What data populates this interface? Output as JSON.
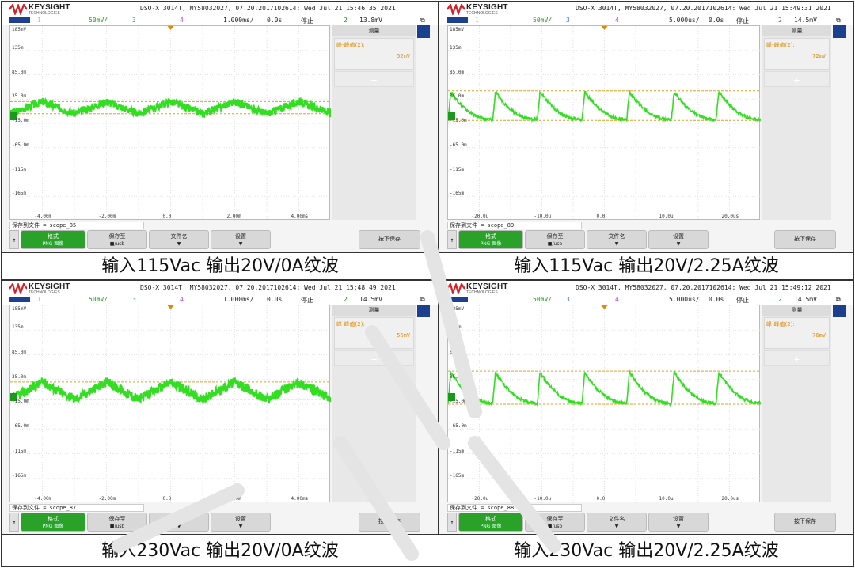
{
  "captions": [
    "输入115Vac 输出20V/0A纹波",
    "输入115Vac 输出20V/2.25A纹波",
    "输入230Vac 输出20V/0A纹波",
    "输入230Vac 输出20V/2.25A纹波"
  ],
  "brand": "KEYSIGHT",
  "brand_sub": "TECHNOLOGIES",
  "panels": [
    {
      "header": "DSO-X 3014T, MY58032027, 07.20.2017102614: Wed Jul 21 15:46:35 2021",
      "ch1": "1",
      "ch2_scale": "50mV/",
      "ch3": "3",
      "ch4": "4",
      "timebase": "1.000ms/",
      "delay": "0.0s",
      "status": "停止",
      "trig_ch": "2",
      "trig_level": "13.8mV",
      "meas_tab": "测量",
      "meas_label": "峰-峰值(2):",
      "meas_value": "52mV",
      "yticks": [
        "185mV",
        "135m",
        "85.0m",
        "35.0m",
        "-15.0m",
        "-65.0m",
        "-115m",
        "-165m"
      ],
      "xticks": [
        "-4.00m",
        "-2.00m",
        "0.0",
        "2.00m",
        "4.00ms"
      ],
      "save_path_label": "保存到文件 =",
      "save_path": "scope_85",
      "buttons": [
        "格式",
        "PNG 图像",
        "保存至",
        "■/usb",
        "文件名",
        "设置",
        "按下保存"
      ]
    },
    {
      "header": "DSO-X 3014T, MY58032027, 07.20.2017102614: Wed Jul 21 15:49:31 2021",
      "ch1": "1",
      "ch2_scale": "50mV/",
      "ch3": "3",
      "ch4": "4",
      "timebase": "5.000us/",
      "delay": "0.0s",
      "status": "停止",
      "trig_ch": "2",
      "trig_level": "14.5mV",
      "meas_tab": "测量",
      "meas_label": "峰-峰值(2):",
      "meas_value": "72mV",
      "yticks": [
        "185mV",
        "135m",
        "85.0m",
        "35.0m",
        "-15.0m",
        "-65.0m",
        "-115m",
        "-165m"
      ],
      "xticks": [
        "-20.0u",
        "-10.0u",
        "0.0",
        "10.0u",
        "20.0us"
      ],
      "save_path_label": "保存到文件 =",
      "save_path": "scope_89",
      "buttons": [
        "格式",
        "PNG 图像",
        "保存至",
        "■/usb",
        "文件名",
        "设置",
        "按下保存"
      ]
    },
    {
      "header": "DSO-X 3014T, MY58032027, 07.20.2017102614: Wed Jul 21 15:48:49 2021",
      "ch1": "1",
      "ch2_scale": "50mV/",
      "ch3": "3",
      "ch4": "4",
      "timebase": "1.000ms/",
      "delay": "0.0s",
      "status": "停止",
      "trig_ch": "2",
      "trig_level": "14.5mV",
      "meas_tab": "测量",
      "meas_label": "峰-峰值(2):",
      "meas_value": "56mV",
      "yticks": [
        "185mV",
        "135m",
        "85.0m",
        "35.0m",
        "-15.0m",
        "-65.0m",
        "-115m",
        "-165m"
      ],
      "xticks": [
        "-4.00m",
        "-2.00m",
        "0.0",
        "2.00m",
        "4.00ms"
      ],
      "save_path_label": "保存到文件 =",
      "save_path": "scope_87",
      "buttons": [
        "格式",
        "PNG 图像",
        "保存至",
        "■/usb",
        "文件名",
        "设置",
        "按下保存"
      ]
    },
    {
      "header": "DSO-X 3014T, MY58032027, 07.20.2017102614: Wed Jul 21 15:49:12 2021",
      "ch1": "1",
      "ch2_scale": "50mV/",
      "ch3": "3",
      "ch4": "4",
      "timebase": "5.000us/",
      "delay": "0.0s",
      "status": "停止",
      "trig_ch": "2",
      "trig_level": "14.5mV",
      "meas_tab": "测量",
      "meas_label": "峰-峰值(2):",
      "meas_value": "76mV",
      "yticks": [
        "185mV",
        "135m",
        "85.0m",
        "35.0m",
        "-15.0m",
        "-65.0m",
        "-115m",
        "-165m"
      ],
      "xticks": [
        "-20.0u",
        "-10.0u",
        "0.0",
        "10.0u",
        "20.0us"
      ],
      "save_path_label": "保存到文件 =",
      "save_path": "scope_88",
      "buttons": [
        "格式",
        "PNG 图像",
        "保存至",
        "■/usb",
        "文件名",
        "设置",
        "按下保存"
      ]
    }
  ],
  "colors": {
    "trace": "#33dd22",
    "cursor": "#e0a020",
    "brand_red": "#d81f26",
    "softkey_green": "#2aa22a",
    "panel_blue": "#1d3f8f"
  },
  "waveforms": [
    {
      "kind": "triangle",
      "periods": 5,
      "top_mV": 30,
      "bottom_mV": 5,
      "noise_mV": 8
    },
    {
      "kind": "sawtooth",
      "periods": 7,
      "top_mV": 50,
      "bottom_mV": -7,
      "noise_mV": 3
    },
    {
      "kind": "triangle",
      "periods": 5,
      "top_mV": 30,
      "bottom_mV": -5,
      "noise_mV": 10
    },
    {
      "kind": "sawtooth",
      "periods": 7,
      "top_mV": 50,
      "bottom_mV": -13,
      "noise_mV": 3
    }
  ]
}
